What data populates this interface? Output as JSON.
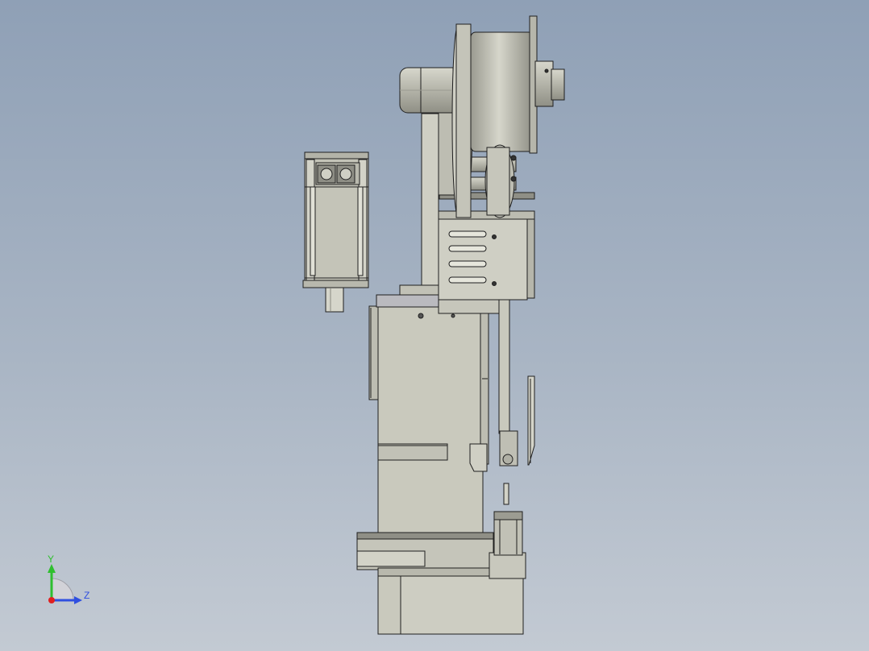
{
  "viewport": {
    "background_top": "#8fa0b6",
    "background_bottom": "#c3cad3"
  },
  "model": {
    "part_fill": "#c9c9bd",
    "part_fill_dark": "#a7a79c",
    "edge_color": "#1f1f1f"
  },
  "triad": {
    "y_label": "Y",
    "z_label": "Z",
    "y_color": "#2fbf2f",
    "z_color": "#2f4fe0",
    "x_color": "#e02020"
  }
}
